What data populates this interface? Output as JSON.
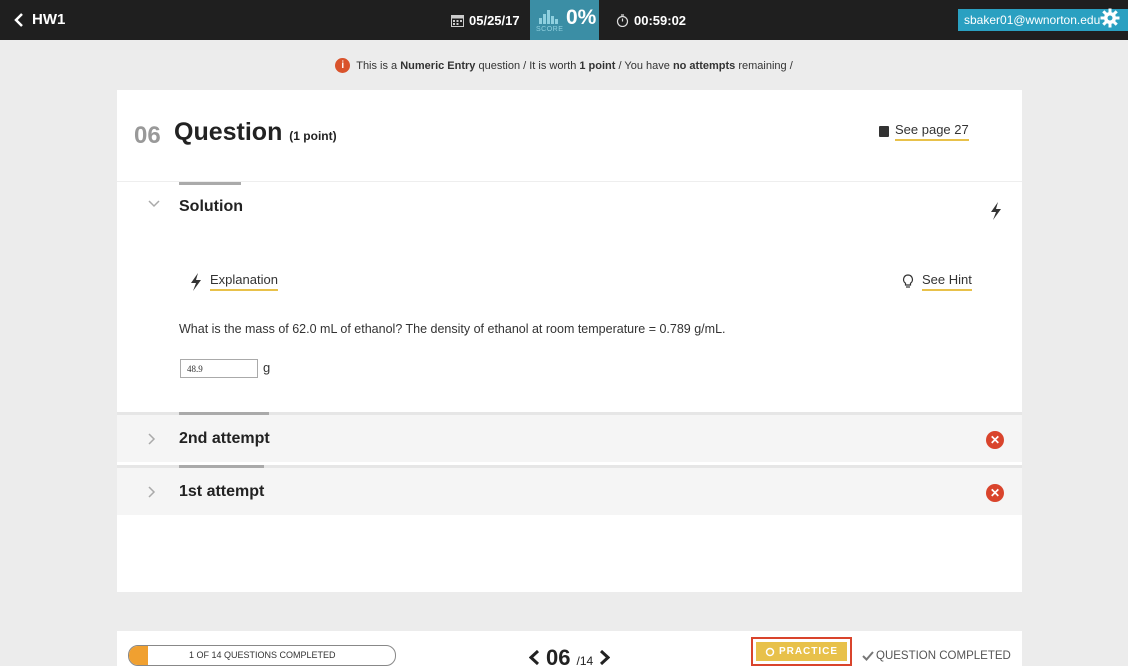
{
  "header": {
    "back_label": "HW1",
    "date": "05/25/17",
    "score_label": "SCORE",
    "score_value": "0%",
    "timer": "00:59:02",
    "user_email": "sbaker01@wwnorton.edu",
    "icons": [
      "chevron-left-icon",
      "calendar-icon",
      "bar-chart-icon",
      "stopwatch-icon",
      "gear-icon"
    ]
  },
  "info": {
    "p1": "This is a ",
    "type": "Numeric Entry",
    "p2": " question / It is worth ",
    "points": "1 point",
    "p3": " / You have ",
    "attempts": "no attempts",
    "p4": " remaining /"
  },
  "question": {
    "number": "06",
    "title": "Question",
    "points_label": "(1 point)",
    "see_page": "See page 27"
  },
  "solution": {
    "title": "Solution",
    "explanation_label": "Explanation",
    "hint_label": "See Hint",
    "question_text": "What is the mass of 62.0 mL of ethanol? The density of ethanol  at room temperature = 0.789 g/mL.",
    "answer_value": "48.9",
    "unit": "g"
  },
  "attempts": [
    {
      "label": "2nd attempt",
      "status": "incorrect"
    },
    {
      "label": "1st attempt",
      "status": "incorrect"
    }
  ],
  "footer": {
    "progress_label": "1 OF 14 QUESTIONS COMPLETED",
    "progress_fraction": 0.0714,
    "current_page": "06",
    "total_pages": "/14",
    "practice_label": "PRACTICE",
    "completed_label": "QUESTION COMPLETED"
  },
  "colors": {
    "accent_yellow": "#e8c14a",
    "error_red": "#d9442c",
    "score_teal": "#3b8ea5",
    "user_blue": "#2aa0c1"
  }
}
